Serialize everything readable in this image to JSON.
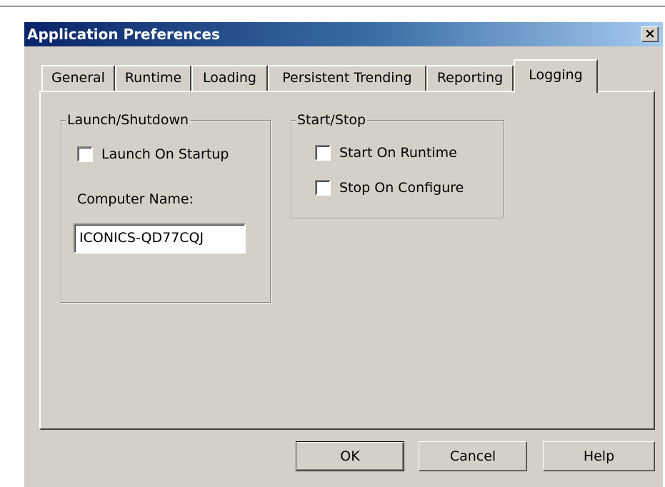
{
  "window": {
    "title": "Application Preferences",
    "close_glyph": "✕"
  },
  "tabs": [
    {
      "label": "General",
      "active": false
    },
    {
      "label": "Runtime",
      "active": false
    },
    {
      "label": "Loading",
      "active": false
    },
    {
      "label": "Persistent Trending",
      "active": false
    },
    {
      "label": "Reporting",
      "active": false
    },
    {
      "label": "Logging",
      "active": true
    }
  ],
  "launch_group": {
    "title": "Launch/Shutdown",
    "launch_on_startup": {
      "label": "Launch On Startup",
      "checked": false
    },
    "computer_name_label": "Computer Name:",
    "computer_name_value": "ICONICS-QD77CQJ"
  },
  "start_group": {
    "title": "Start/Stop",
    "start_on_runtime": {
      "label": "Start On Runtime",
      "checked": false
    },
    "stop_on_configure": {
      "label": "Stop On Configure",
      "checked": false
    }
  },
  "buttons": {
    "ok": "OK",
    "cancel": "Cancel",
    "help": "Help"
  },
  "colors": {
    "face": "#d4d0c8",
    "title_start": "#0a246a",
    "title_end": "#a6caf0"
  }
}
